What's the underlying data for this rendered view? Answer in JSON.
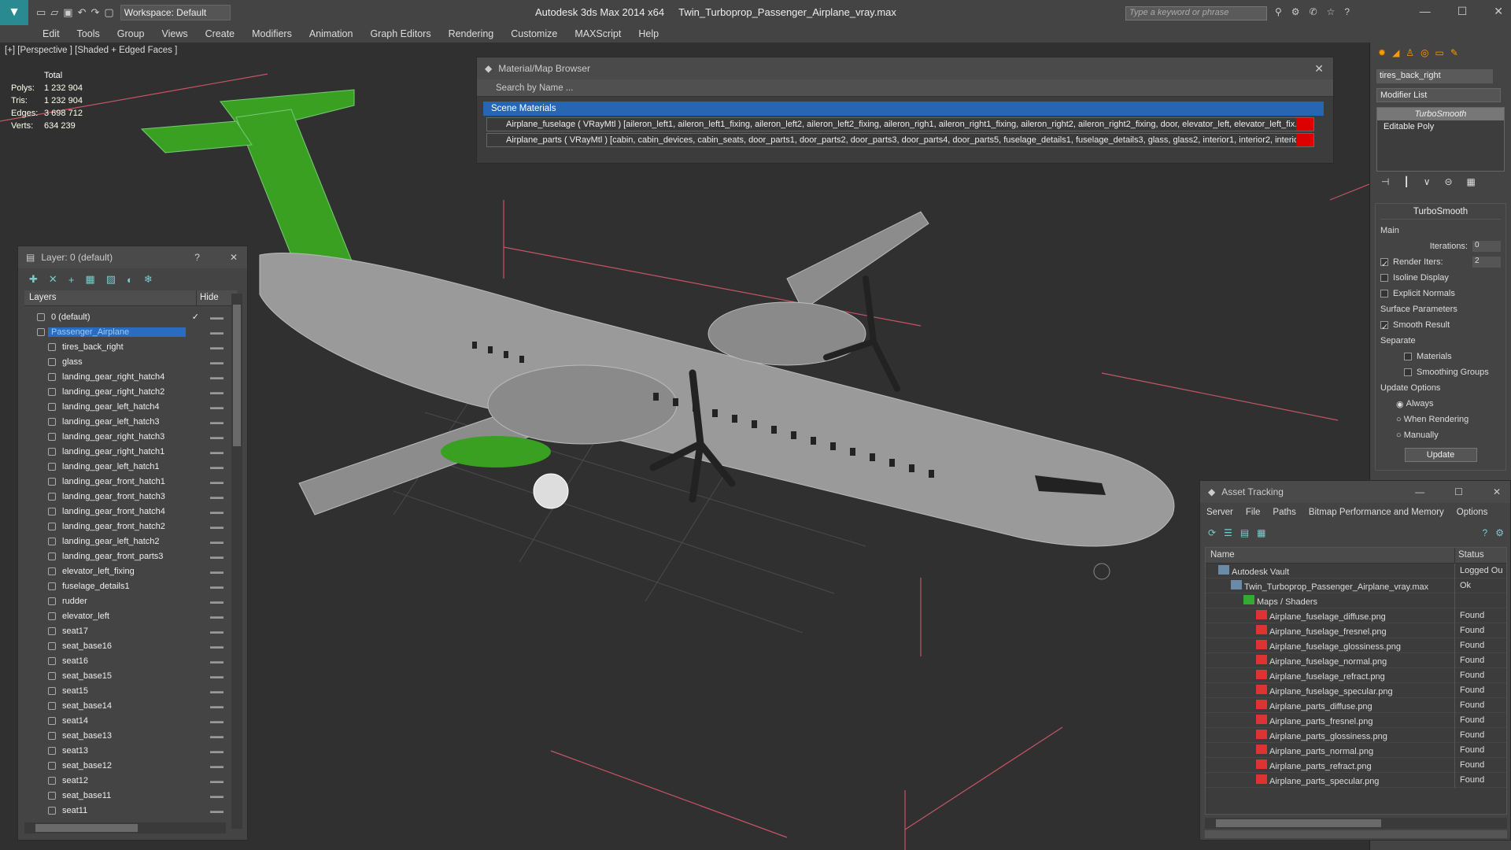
{
  "app": {
    "title": "Autodesk 3ds Max  2014 x64",
    "file": "Twin_Turboprop_Passenger_Airplane_vray.max",
    "workspace": "Workspace: Default",
    "keyword_placeholder": "Type a keyword or phrase"
  },
  "menu": [
    "Edit",
    "Tools",
    "Group",
    "Views",
    "Create",
    "Modifiers",
    "Animation",
    "Graph Editors",
    "Rendering",
    "Customize",
    "MAXScript",
    "Help"
  ],
  "viewport": {
    "label": "[+] [Perspective ] [Shaded + Edged Faces ]",
    "stats": {
      "total_label": "Total",
      "rows": [
        {
          "label": "Polys:",
          "value": "1 232 904"
        },
        {
          "label": "Tris:",
          "value": "1 232 904"
        },
        {
          "label": "Edges:",
          "value": "3 698 712"
        },
        {
          "label": "Verts:",
          "value": "634 239"
        }
      ]
    }
  },
  "material_browser": {
    "title": "Material/Map Browser",
    "search": "Search by Name ...",
    "section": "Scene Materials",
    "rows": [
      "Airplane_fuselage ( VRayMtl ) [aileron_left1, aileron_left1_fixing, aileron_left2, aileron_left2_fixing, aileron_righ1, aileron_right1_fixing, aileron_right2, aileron_right2_fixing, door, elevator_left, elevator_left_fix...",
      "Airplane_parts ( VRayMtl ) [cabin, cabin_devices, cabin_seats, door_parts1, door_parts2, door_parts3, door_parts4, door_parts5, fuselage_details1, fuselage_details3, glass, glass2, interior1, interior2, interior..."
    ]
  },
  "layer_panel": {
    "title": "Layer: 0 (default)",
    "help": "?",
    "col_layers": "Layers",
    "col_hide": "Hide",
    "items": [
      {
        "name": "0 (default)",
        "level": 1,
        "check": "✓"
      },
      {
        "name": "Passenger_Airplane",
        "level": 1,
        "selected": true
      },
      {
        "name": "tires_back_right",
        "level": 2
      },
      {
        "name": "glass",
        "level": 2
      },
      {
        "name": "landing_gear_right_hatch4",
        "level": 2
      },
      {
        "name": "landing_gear_right_hatch2",
        "level": 2
      },
      {
        "name": "landing_gear_left_hatch4",
        "level": 2
      },
      {
        "name": "landing_gear_left_hatch3",
        "level": 2
      },
      {
        "name": "landing_gear_right_hatch3",
        "level": 2
      },
      {
        "name": "landing_gear_right_hatch1",
        "level": 2
      },
      {
        "name": "landing_gear_left_hatch1",
        "level": 2
      },
      {
        "name": "landing_gear_front_hatch1",
        "level": 2
      },
      {
        "name": "landing_gear_front_hatch3",
        "level": 2
      },
      {
        "name": "landing_gear_front_hatch4",
        "level": 2
      },
      {
        "name": "landing_gear_front_hatch2",
        "level": 2
      },
      {
        "name": "landing_gear_left_hatch2",
        "level": 2
      },
      {
        "name": "landing_gear_front_parts3",
        "level": 2
      },
      {
        "name": "elevator_left_fixing",
        "level": 2
      },
      {
        "name": "fuselage_details1",
        "level": 2
      },
      {
        "name": "rudder",
        "level": 2
      },
      {
        "name": "elevator_left",
        "level": 2
      },
      {
        "name": "seat17",
        "level": 2
      },
      {
        "name": "seat_base16",
        "level": 2
      },
      {
        "name": "seat16",
        "level": 2
      },
      {
        "name": "seat_base15",
        "level": 2
      },
      {
        "name": "seat15",
        "level": 2
      },
      {
        "name": "seat_base14",
        "level": 2
      },
      {
        "name": "seat14",
        "level": 2
      },
      {
        "name": "seat_base13",
        "level": 2
      },
      {
        "name": "seat13",
        "level": 2
      },
      {
        "name": "seat_base12",
        "level": 2
      },
      {
        "name": "seat12",
        "level": 2
      },
      {
        "name": "seat_base11",
        "level": 2
      },
      {
        "name": "seat11",
        "level": 2
      }
    ]
  },
  "command_panel": {
    "object_name": "tires_back_right",
    "modifier_list": "Modifier List",
    "stack": [
      "TurboSmooth",
      "Editable Poly"
    ],
    "turbosmooth": {
      "title": "TurboSmooth",
      "main": "Main",
      "iterations_label": "Iterations:",
      "iterations": "0",
      "render_iters_label": "Render Iters:",
      "render_iters": "2",
      "isoline": "Isoline Display",
      "explicit": "Explicit Normals",
      "surface": "Surface Parameters",
      "smooth_result": "Smooth Result",
      "separate": "Separate",
      "materials": "Materials",
      "smoothing_groups": "Smoothing Groups",
      "update_options": "Update Options",
      "always": "Always",
      "when_rendering": "When Rendering",
      "manually": "Manually",
      "update": "Update"
    }
  },
  "asset_tracking": {
    "title": "Asset Tracking",
    "menu": [
      "Server",
      "File",
      "Paths",
      "Bitmap Performance and Memory",
      "Options"
    ],
    "col_name": "Name",
    "col_status": "Status",
    "rows": [
      {
        "name": "Autodesk Vault",
        "status": "Logged Ou",
        "indent": 1
      },
      {
        "name": "Twin_Turboprop_Passenger_Airplane_vray.max",
        "status": "Ok",
        "indent": 2
      },
      {
        "name": "Maps / Shaders",
        "status": "",
        "indent": 3
      },
      {
        "name": "Airplane_fuselage_diffuse.png",
        "status": "Found",
        "indent": 4
      },
      {
        "name": "Airplane_fuselage_fresnel.png",
        "status": "Found",
        "indent": 4
      },
      {
        "name": "Airplane_fuselage_glossiness.png",
        "status": "Found",
        "indent": 4
      },
      {
        "name": "Airplane_fuselage_normal.png",
        "status": "Found",
        "indent": 4
      },
      {
        "name": "Airplane_fuselage_refract.png",
        "status": "Found",
        "indent": 4
      },
      {
        "name": "Airplane_fuselage_specular.png",
        "status": "Found",
        "indent": 4
      },
      {
        "name": "Airplane_parts_diffuse.png",
        "status": "Found",
        "indent": 4
      },
      {
        "name": "Airplane_parts_fresnel.png",
        "status": "Found",
        "indent": 4
      },
      {
        "name": "Airplane_parts_glossiness.png",
        "status": "Found",
        "indent": 4
      },
      {
        "name": "Airplane_parts_normal.png",
        "status": "Found",
        "indent": 4
      },
      {
        "name": "Airplane_parts_refract.png",
        "status": "Found",
        "indent": 4
      },
      {
        "name": "Airplane_parts_specular.png",
        "status": "Found",
        "indent": 4
      }
    ]
  }
}
